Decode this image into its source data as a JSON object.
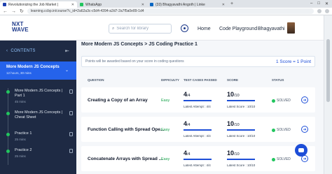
{
  "browser": {
    "tabs": [
      {
        "label": "Revolutionizing the Job Market |",
        "active": true,
        "favicon_color": "#1e40af"
      },
      {
        "label": "WhatsApp",
        "active": false,
        "favicon_color": "#22c55e"
      },
      {
        "label": "(33) Bhagyavathi Angoth | Linke",
        "active": false,
        "favicon_color": "#0a66c2"
      }
    ],
    "url": "learning.ccbp.in/course?c_id=2a62a3c-c5d4-4394-a2d7-2a7f5a0e89-1d4"
  },
  "header": {
    "logo_line1": "NXT",
    "logo_line2": "WAVE",
    "search_placeholder": "Search for library",
    "nav": [
      "Home",
      "Code Playground",
      "Bhagyavathi"
    ]
  },
  "sidebar": {
    "title": "CONTENTS",
    "course": {
      "title": "More Modern JS Concepts",
      "duration": "12 hours, 30 mins"
    },
    "items": [
      {
        "label": "More Modern JS Concepts | Part 1",
        "sub": "45 mins"
      },
      {
        "label": "More Modern JS Concepts | Cheat Sheet",
        "sub": ""
      },
      {
        "label": "Practice 1",
        "sub": "25 mins"
      },
      {
        "label": "Practice 2",
        "sub": "25 mins"
      }
    ]
  },
  "main": {
    "breadcrumb": "More Modern JS Concepts > JS Coding Practice 1",
    "info_message": "Points will be awarded based on your score in coding questions",
    "score_text": "1 Score = 1 Point",
    "columns": [
      "QUESTION",
      "DIFFICULTY",
      "TEST CASES PASSED",
      "SCORE",
      "STATUS"
    ],
    "rows": [
      {
        "name": "Creating a Copy of an Array",
        "difficulty": "Easy",
        "tests": "4",
        "tests_total": "/4",
        "tests_latest": "Latest Attempt : 4/4",
        "score": "10",
        "score_total": "/10",
        "score_latest": "Latest Score : 10/10",
        "status": "SOLVED"
      },
      {
        "name": "Function Calling with Spread Ope...",
        "difficulty": "Easy",
        "tests": "4",
        "tests_total": "/4",
        "tests_latest": "Latest Attempt : 4/4",
        "score": "10",
        "score_total": "/10",
        "score_latest": "Latest Score : 10/10",
        "status": "SOLVED"
      },
      {
        "name": "Concatenate Arrays with Spread ...",
        "difficulty": "Easy",
        "tests": "4",
        "tests_total": "/4",
        "tests_latest": "Latest Attempt : 4/4",
        "score": "10",
        "score_total": "/10",
        "score_latest": "Latest Score : 10/10",
        "status": "SOLVED"
      }
    ]
  },
  "colors": {
    "accent": "#1d4ed8",
    "sidebar_bg": "#1e2a44",
    "success": "#22c55e"
  }
}
